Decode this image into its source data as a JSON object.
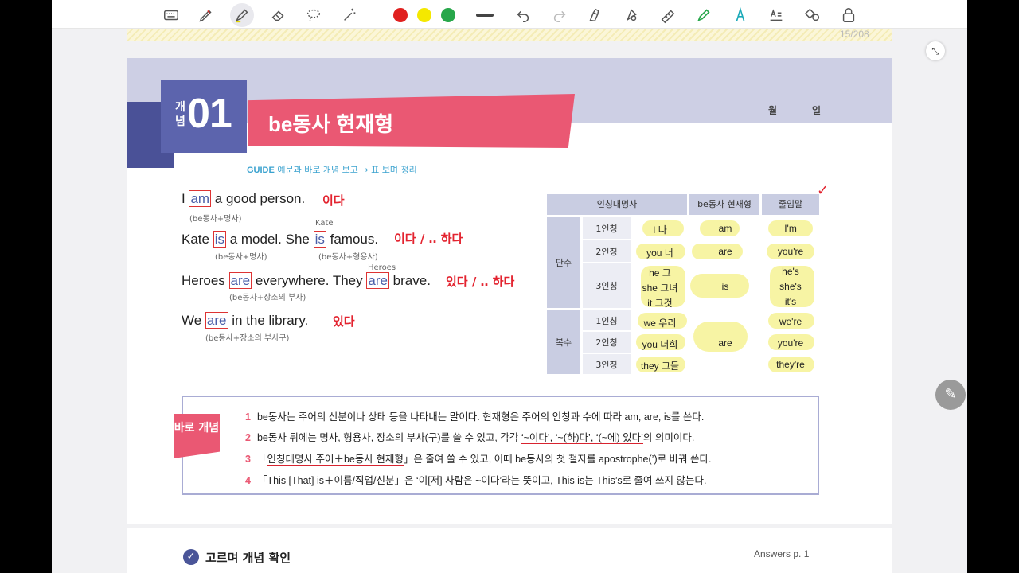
{
  "toolbar": {
    "tools": [
      "keyboard-icon",
      "pen-icon",
      "highlighter-icon",
      "eraser-icon",
      "lasso-icon",
      "magic-icon"
    ],
    "colors": [
      "#e0201f",
      "#f4e800",
      "#27a74a"
    ],
    "right_tools": [
      "undo-icon",
      "redo-icon",
      "hand-draw-icon",
      "shape-icon",
      "ruler-icon",
      "marker-icon",
      "text-pen-icon",
      "text-box-icon",
      "shapes-icon",
      "lock-icon"
    ]
  },
  "page_counter": "15/208",
  "header": {
    "concept_prefix": "개념",
    "concept_number": "01",
    "title": "be동사 현재형",
    "month": "월",
    "day": "일"
  },
  "guide": {
    "label": "GUIDE",
    "text": "예문과 바로 개념 보고 → 표 보며 정리"
  },
  "examples": [
    {
      "before": "I ",
      "kw": "am",
      "after": " a good person.",
      "note": "(be동사+명사)",
      "hw": "이다"
    },
    {
      "before": "Kate ",
      "kw": "is",
      "mid": " a model. She ",
      "kw2": "is",
      "after": " famous.",
      "note": "(be동사+명사)",
      "note2": "(be동사+형용사)",
      "hw": "이다  /  ‥ 하다",
      "ref": "Kate"
    },
    {
      "before": "Heroes ",
      "kw": "are",
      "mid": " everywhere. They ",
      "kw2": "are",
      "after": " brave.",
      "note": "(be동사+장소의 부사)",
      "hw": "있다 / ‥ 하다",
      "ref": "Heroes"
    },
    {
      "before": "We ",
      "kw": "are",
      "after": " in the library.",
      "note": "(be동사+장소의 부사구)",
      "hw": "있다"
    }
  ],
  "table": {
    "headers": [
      "인칭대명사",
      "be동사 현재형",
      "줄임말"
    ],
    "groups": [
      "단수",
      "복수"
    ],
    "rows": [
      {
        "person": "1인칭",
        "pronoun": "I 나",
        "be": "am",
        "short": "I'm"
      },
      {
        "person": "2인칭",
        "pronoun": "you 너",
        "be": "are",
        "short": "you're"
      },
      {
        "person": "3인칭",
        "pronoun1": "he 그",
        "pronoun2": "she 그녀",
        "pronoun3": "it 그것",
        "be": "is",
        "short1": "he's",
        "short2": "she's",
        "short3": "it's"
      },
      {
        "person": "1인칭",
        "pronoun": "we 우리",
        "short": "we're"
      },
      {
        "person": "2인칭",
        "pronoun": "you 너희",
        "be": "are",
        "short": "you're"
      },
      {
        "person": "3인칭",
        "pronoun": "they 그들",
        "short": "they're"
      }
    ],
    "check_mark": "✓"
  },
  "summary": {
    "tag": "바로 개념",
    "items": [
      {
        "num": "1",
        "a": "be동사는 주어의 신분이나 상태 등을 나타내는 말이다. 현재형은 주어의 인칭과 수에 따라 ",
        "u": "am, are, is",
        "b": "를 쓴다."
      },
      {
        "num": "2",
        "a": "be동사 뒤에는 명사, 형용사, 장소의 부사(구)를 쓸 수 있고, 각각 ",
        "u": "‘~이다’, ‘~(하)다’, ‘(~에) 있다’",
        "b": "의 의미이다."
      },
      {
        "num": "3",
        "a": "「",
        "u": "인칭대명사 주어＋be동사 현재형",
        "b": "」은 줄여 쓸 수 있고, 이때 be동사의 첫 철자를 apostrophe(’)로 바꿔 쓴다."
      },
      {
        "num": "4",
        "a": "「This [That] is＋이름/직업/신분」은 ‘이[저] 사람은 ~이다’라는 뜻이고, This is는 This’s로 줄여 쓰지 않는다.",
        "u": "",
        "b": ""
      }
    ]
  },
  "next_section": {
    "title": "고르며 개념 확인",
    "answers": "Answers p. 1"
  }
}
